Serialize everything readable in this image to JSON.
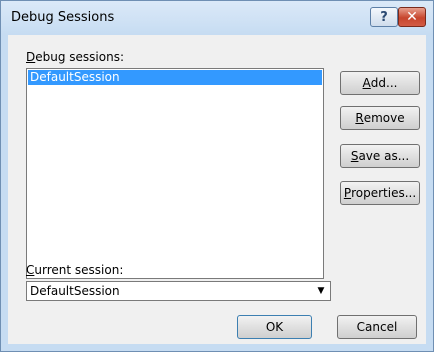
{
  "window": {
    "title": "Debug Sessions",
    "help_glyph": "?",
    "close_glyph": "✕"
  },
  "sessions": {
    "label_accel": "D",
    "label_rest": "ebug sessions:",
    "items": [
      "DefaultSession"
    ],
    "selected_index": 0
  },
  "buttons": {
    "add_accel": "A",
    "add_rest": "dd...",
    "remove_accel": "R",
    "remove_rest": "emove",
    "save_accel": "S",
    "save_rest": "ave as...",
    "properties_accel": "P",
    "properties_rest": "roperties...",
    "ok": "OK",
    "cancel": "Cancel"
  },
  "current_session": {
    "label_accel": "C",
    "label_rest": "urrent session:",
    "value": "DefaultSession",
    "arrow_glyph": "▼"
  }
}
